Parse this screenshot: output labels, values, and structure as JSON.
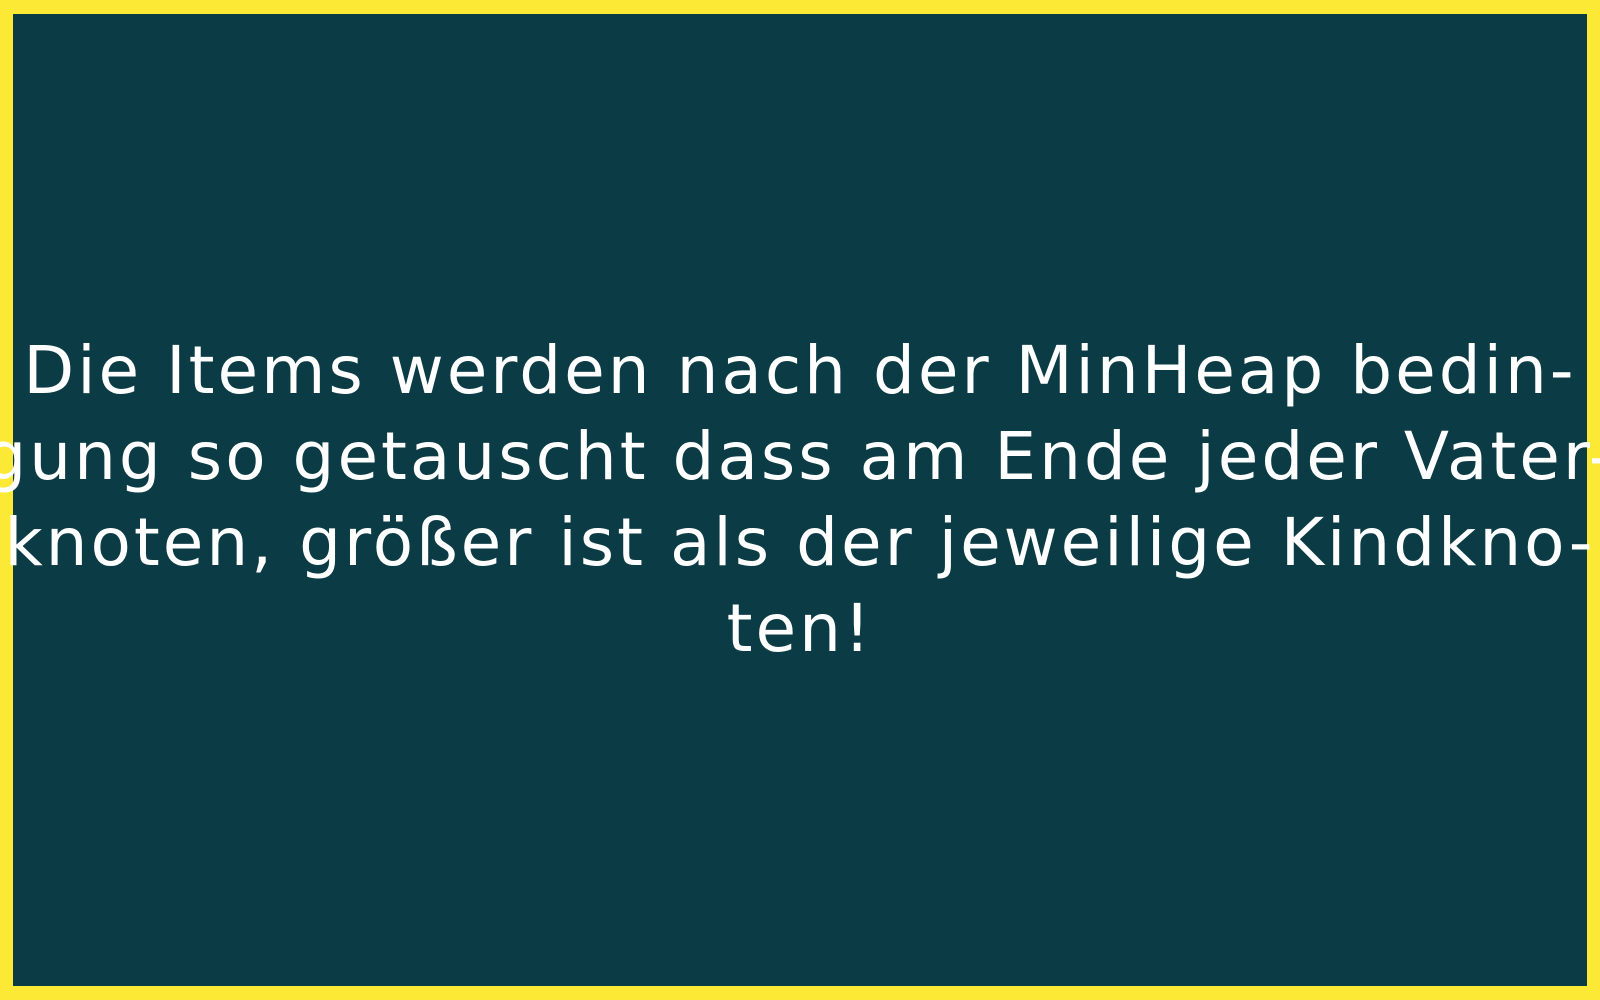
{
  "slide": {
    "lines": [
      "Die Items werden nach der MinHeap bedin-",
      "gung so getauscht dass am Ende jeder Vater-",
      "knoten, größer ist als der jeweilige Kindkno-",
      "ten!"
    ]
  },
  "colors": {
    "border": "#fbe935",
    "background": "#0b3c45",
    "text": "#ffffff"
  }
}
